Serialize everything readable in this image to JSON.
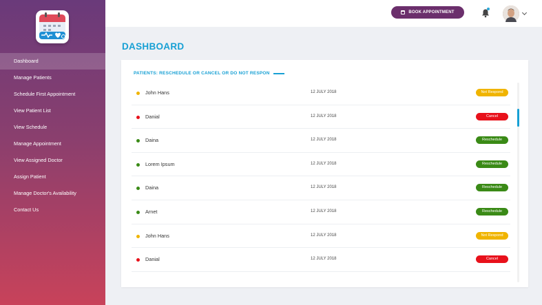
{
  "header": {
    "book_label": "BOOK APPOINTMENT"
  },
  "sidebar": {
    "items": [
      {
        "label": "Dashboard",
        "active": true
      },
      {
        "label": "Manage Patients"
      },
      {
        "label": "Schedule First Appointment"
      },
      {
        "label": "View Patient List"
      },
      {
        "label": "View Schedule"
      },
      {
        "label": "Manage Appointment"
      },
      {
        "label": "View Assigned Doctor"
      },
      {
        "label": "Assign Patient"
      },
      {
        "label": "Manage Doctor's Availability"
      },
      {
        "label": "Contact Us"
      }
    ]
  },
  "main": {
    "title": "DASHBOARD",
    "card_heading": "PATIENTS: RESCHEDULE OR CANCEL OR DO NOT RESPON",
    "rows": [
      {
        "name": "John Hans",
        "date": "12 JULY 2018",
        "status": "Not Respond",
        "dot_color": "#f0b400",
        "badge_color": "#f0b400"
      },
      {
        "name": "Danial",
        "date": "12 JULY 2018",
        "status": "Cancel",
        "dot_color": "#e8111b",
        "badge_color": "#e8111b"
      },
      {
        "name": "Daina",
        "date": "12 JULY 2018",
        "status": "Reschedule",
        "dot_color": "#3a8a16",
        "badge_color": "#3a8a16"
      },
      {
        "name": "Lorem Ipsum",
        "date": "12 JULY 2018",
        "status": "Reschedule",
        "dot_color": "#3a8a16",
        "badge_color": "#3a8a16"
      },
      {
        "name": "Daina",
        "date": "12 JULY 2018",
        "status": "Reschedule",
        "dot_color": "#3a8a16",
        "badge_color": "#3a8a16"
      },
      {
        "name": "Arnet",
        "date": "12 JULY 2018",
        "status": "Reschedule",
        "dot_color": "#3a8a16",
        "badge_color": "#3a8a16"
      },
      {
        "name": "John Hans",
        "date": "12 JULY 2018",
        "status": "Not Respond",
        "dot_color": "#f0b400",
        "badge_color": "#f0b400"
      },
      {
        "name": "Danial",
        "date": "12 JULY 2018",
        "status": "Cancel",
        "dot_color": "#e8111b",
        "badge_color": "#e8111b"
      }
    ]
  },
  "colors": {
    "accent": "#17a0d4",
    "button": "#6b2f6c"
  },
  "icons": {
    "logo": "calendar-medical-logo-icon",
    "notifications": "bell-icon",
    "book": "calendar-icon"
  }
}
